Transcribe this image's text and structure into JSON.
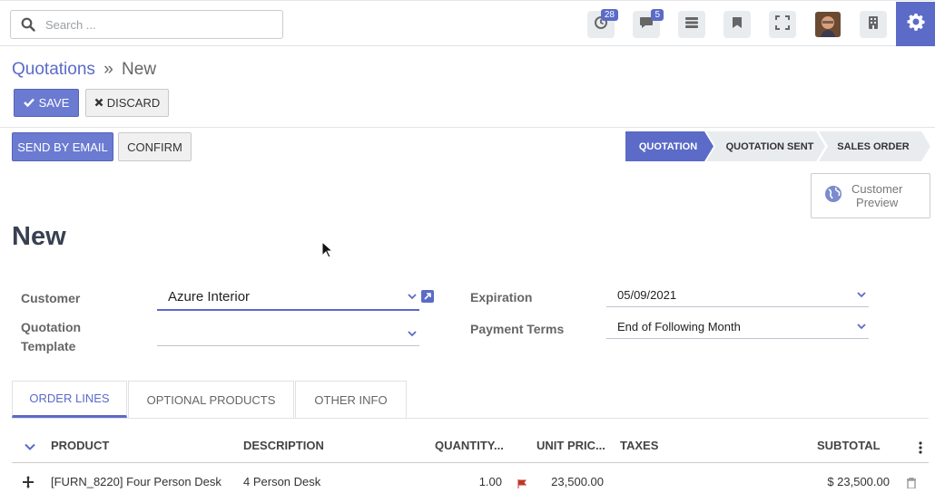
{
  "topbar": {
    "search_placeholder": "Search ...",
    "activity_count": "28",
    "messages_count": "5",
    "icons": [
      "activity-clock-icon",
      "chat-icon",
      "menu-bars-icon",
      "bookmark-icon",
      "fullscreen-icon",
      "avatar",
      "company-switch-icon",
      "settings-gear-icon"
    ]
  },
  "breadcrumb": {
    "parent": "Quotations",
    "separator": "»",
    "current": "New"
  },
  "actions": {
    "save": "SAVE",
    "discard": "DISCARD"
  },
  "header_buttons": {
    "send_email": "SEND BY EMAIL",
    "confirm": "CONFIRM"
  },
  "status_stages": [
    {
      "label": "QUOTATION",
      "active": true
    },
    {
      "label": "QUOTATION SENT",
      "active": false
    },
    {
      "label": "SALES ORDER",
      "active": false
    }
  ],
  "preview": {
    "line1": "Customer",
    "line2": "Preview"
  },
  "form": {
    "title": "New",
    "customer_label": "Customer",
    "customer_value": "Azure Interior",
    "template_label_1": "Quotation",
    "template_label_2": "Template",
    "template_value": "",
    "expiration_label": "Expiration",
    "expiration_value": "05/09/2021",
    "payment_label": "Payment Terms",
    "payment_value": "End of Following Month"
  },
  "tabs": [
    "ORDER LINES",
    "OPTIONAL PRODUCTS",
    "OTHER INFO"
  ],
  "table": {
    "headers": {
      "product": "PRODUCT",
      "description": "DESCRIPTION",
      "quantity": "QUANTITY...",
      "unit_price": "UNIT PRIC...",
      "taxes": "TAXES",
      "subtotal": "SUBTOTAL"
    },
    "rows": [
      {
        "product": "[FURN_8220] Four Person Desk",
        "description": "4 Person Desk",
        "quantity": "1.00",
        "unit_price": "23,500.00",
        "taxes": "",
        "subtotal": "$ 23,500.00"
      }
    ]
  },
  "colors": {
    "accent": "#5b6bc7",
    "button_primary": "#6b7bd1",
    "stage_active": "#5b6bc7",
    "stage_inactive": "#e9ecef"
  }
}
